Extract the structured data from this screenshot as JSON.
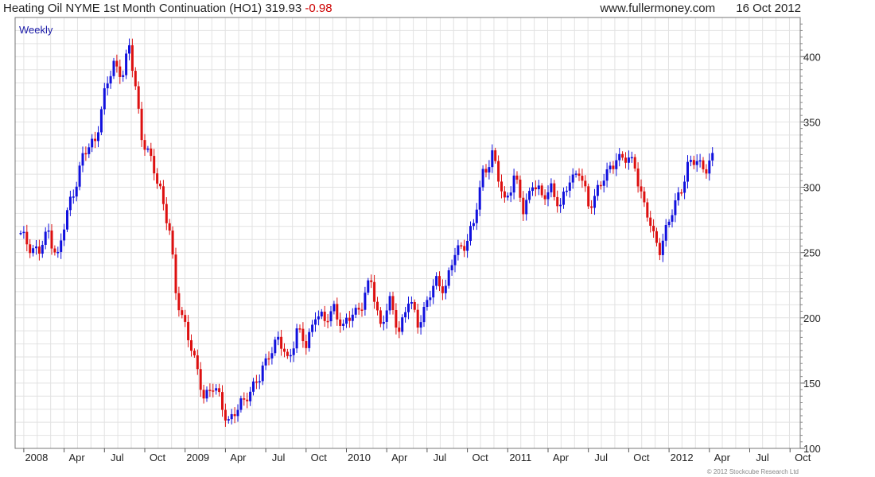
{
  "header": {
    "instrument": "Heating Oil NYME 1st Month Continuation (HO1)",
    "last": "319.93",
    "change": "-0.98",
    "site": "www.fullermoney.com",
    "date": "16 Oct 2012"
  },
  "footer": {
    "copyright": "© 2012 Stockcube Research Ltd"
  },
  "colors": {
    "up": "#1010dd",
    "down": "#dd1010",
    "grid": "#e2e2e2"
  },
  "chart_data": {
    "type": "ohlc-bar",
    "period_label": "Weekly",
    "x_ticks": [
      "2008",
      "Apr",
      "Jul",
      "Oct",
      "2009",
      "Apr",
      "Jul",
      "Oct",
      "2010",
      "Apr",
      "Jul",
      "Oct",
      "2011",
      "Apr",
      "Jul",
      "Oct",
      "2012",
      "Apr",
      "Jul",
      "Oct"
    ],
    "y_ticks": [
      100,
      150,
      200,
      250,
      300,
      350,
      400
    ],
    "ylim": [
      100,
      430
    ],
    "grid": true,
    "weekly_close_keypoints": [
      {
        "t": 0,
        "v": 262
      },
      {
        "t": 6,
        "v": 250
      },
      {
        "t": 9,
        "v": 266
      },
      {
        "t": 12,
        "v": 247
      },
      {
        "t": 16,
        "v": 290
      },
      {
        "t": 20,
        "v": 322
      },
      {
        "t": 24,
        "v": 338
      },
      {
        "t": 27,
        "v": 370
      },
      {
        "t": 30,
        "v": 395
      },
      {
        "t": 33,
        "v": 388
      },
      {
        "t": 35,
        "v": 405
      },
      {
        "t": 37,
        "v": 378
      },
      {
        "t": 39,
        "v": 340
      },
      {
        "t": 42,
        "v": 318
      },
      {
        "t": 45,
        "v": 300
      },
      {
        "t": 48,
        "v": 265
      },
      {
        "t": 50,
        "v": 218
      },
      {
        "t": 53,
        "v": 196
      },
      {
        "t": 56,
        "v": 165
      },
      {
        "t": 59,
        "v": 142
      },
      {
        "t": 62,
        "v": 146
      },
      {
        "t": 64,
        "v": 138
      },
      {
        "t": 67,
        "v": 122
      },
      {
        "t": 70,
        "v": 128
      },
      {
        "t": 73,
        "v": 143
      },
      {
        "t": 77,
        "v": 152
      },
      {
        "t": 80,
        "v": 175
      },
      {
        "t": 83,
        "v": 182
      },
      {
        "t": 86,
        "v": 168
      },
      {
        "t": 89,
        "v": 190
      },
      {
        "t": 92,
        "v": 178
      },
      {
        "t": 95,
        "v": 205
      },
      {
        "t": 98,
        "v": 195
      },
      {
        "t": 101,
        "v": 210
      },
      {
        "t": 104,
        "v": 190
      },
      {
        "t": 107,
        "v": 205
      },
      {
        "t": 110,
        "v": 210
      },
      {
        "t": 113,
        "v": 228
      },
      {
        "t": 116,
        "v": 195
      },
      {
        "t": 119,
        "v": 210
      },
      {
        "t": 122,
        "v": 192
      },
      {
        "t": 125,
        "v": 212
      },
      {
        "t": 128,
        "v": 197
      },
      {
        "t": 131,
        "v": 212
      },
      {
        "t": 134,
        "v": 227
      },
      {
        "t": 137,
        "v": 225
      },
      {
        "t": 140,
        "v": 248
      },
      {
        "t": 143,
        "v": 258
      },
      {
        "t": 146,
        "v": 270
      },
      {
        "t": 149,
        "v": 312
      },
      {
        "t": 152,
        "v": 325
      },
      {
        "t": 154,
        "v": 305
      },
      {
        "t": 156,
        "v": 290
      },
      {
        "t": 159,
        "v": 308
      },
      {
        "t": 162,
        "v": 282
      },
      {
        "t": 165,
        "v": 305
      },
      {
        "t": 168,
        "v": 290
      },
      {
        "t": 171,
        "v": 302
      },
      {
        "t": 174,
        "v": 282
      },
      {
        "t": 177,
        "v": 308
      },
      {
        "t": 180,
        "v": 312
      },
      {
        "t": 183,
        "v": 285
      },
      {
        "t": 186,
        "v": 300
      },
      {
        "t": 189,
        "v": 308
      },
      {
        "t": 192,
        "v": 325
      },
      {
        "t": 195,
        "v": 320
      },
      {
        "t": 198,
        "v": 318
      },
      {
        "t": 201,
        "v": 285
      },
      {
        "t": 204,
        "v": 262
      },
      {
        "t": 206,
        "v": 255
      },
      {
        "t": 209,
        "v": 272
      },
      {
        "t": 212,
        "v": 295
      },
      {
        "t": 215,
        "v": 315
      },
      {
        "t": 218,
        "v": 320
      },
      {
        "t": 221,
        "v": 316
      },
      {
        "t": 223,
        "v": 320
      }
    ],
    "x_tick_positions_week": [
      1,
      14,
      27,
      40,
      53,
      66,
      79,
      92,
      105,
      118,
      131,
      144,
      157,
      170,
      183,
      196,
      209,
      222,
      235,
      248
    ]
  }
}
